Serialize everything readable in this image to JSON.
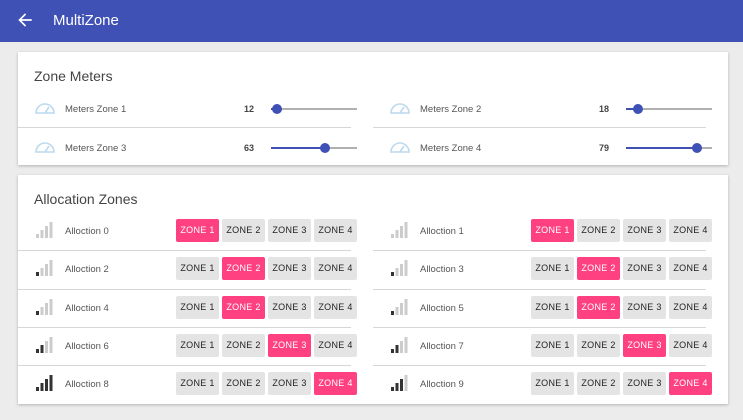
{
  "app": {
    "title": "MultiZone",
    "back_icon": "arrow-left-icon"
  },
  "colors": {
    "primary": "#3f51b5",
    "accent": "#ff4081",
    "meter_icon": "#bcd9ee",
    "signal_dark": "#333333",
    "signal_light": "#cccccc"
  },
  "zone_meters": {
    "title": "Zone Meters",
    "items": [
      {
        "label": "Meters Zone 1",
        "value": "12",
        "level": 0.07
      },
      {
        "label": "Meters Zone 2",
        "value": "18",
        "level": 0.14
      },
      {
        "label": "Meters Zone 3",
        "value": "63",
        "level": 0.63
      },
      {
        "label": "Meters Zone 4",
        "value": "79",
        "level": 0.83
      }
    ]
  },
  "allocation_zones": {
    "title": "Allocation Zones",
    "zone_labels": [
      "ZONE 1",
      "ZONE 2",
      "ZONE 3",
      "ZONE 4"
    ],
    "items": [
      {
        "label": "Alloction 0",
        "active_zone": 0,
        "signal_bars": 0
      },
      {
        "label": "Alloction 1",
        "active_zone": 0,
        "signal_bars": 0
      },
      {
        "label": "Alloction 2",
        "active_zone": 1,
        "signal_bars": 1
      },
      {
        "label": "Alloction 3",
        "active_zone": 1,
        "signal_bars": 1
      },
      {
        "label": "Alloction 4",
        "active_zone": 1,
        "signal_bars": 1
      },
      {
        "label": "Alloction 5",
        "active_zone": 1,
        "signal_bars": 1
      },
      {
        "label": "Alloction 6",
        "active_zone": 2,
        "signal_bars": 2
      },
      {
        "label": "Alloction 7",
        "active_zone": 2,
        "signal_bars": 2
      },
      {
        "label": "Alloction 8",
        "active_zone": 3,
        "signal_bars": 4
      },
      {
        "label": "Alloction 9",
        "active_zone": 3,
        "signal_bars": 3
      }
    ]
  }
}
